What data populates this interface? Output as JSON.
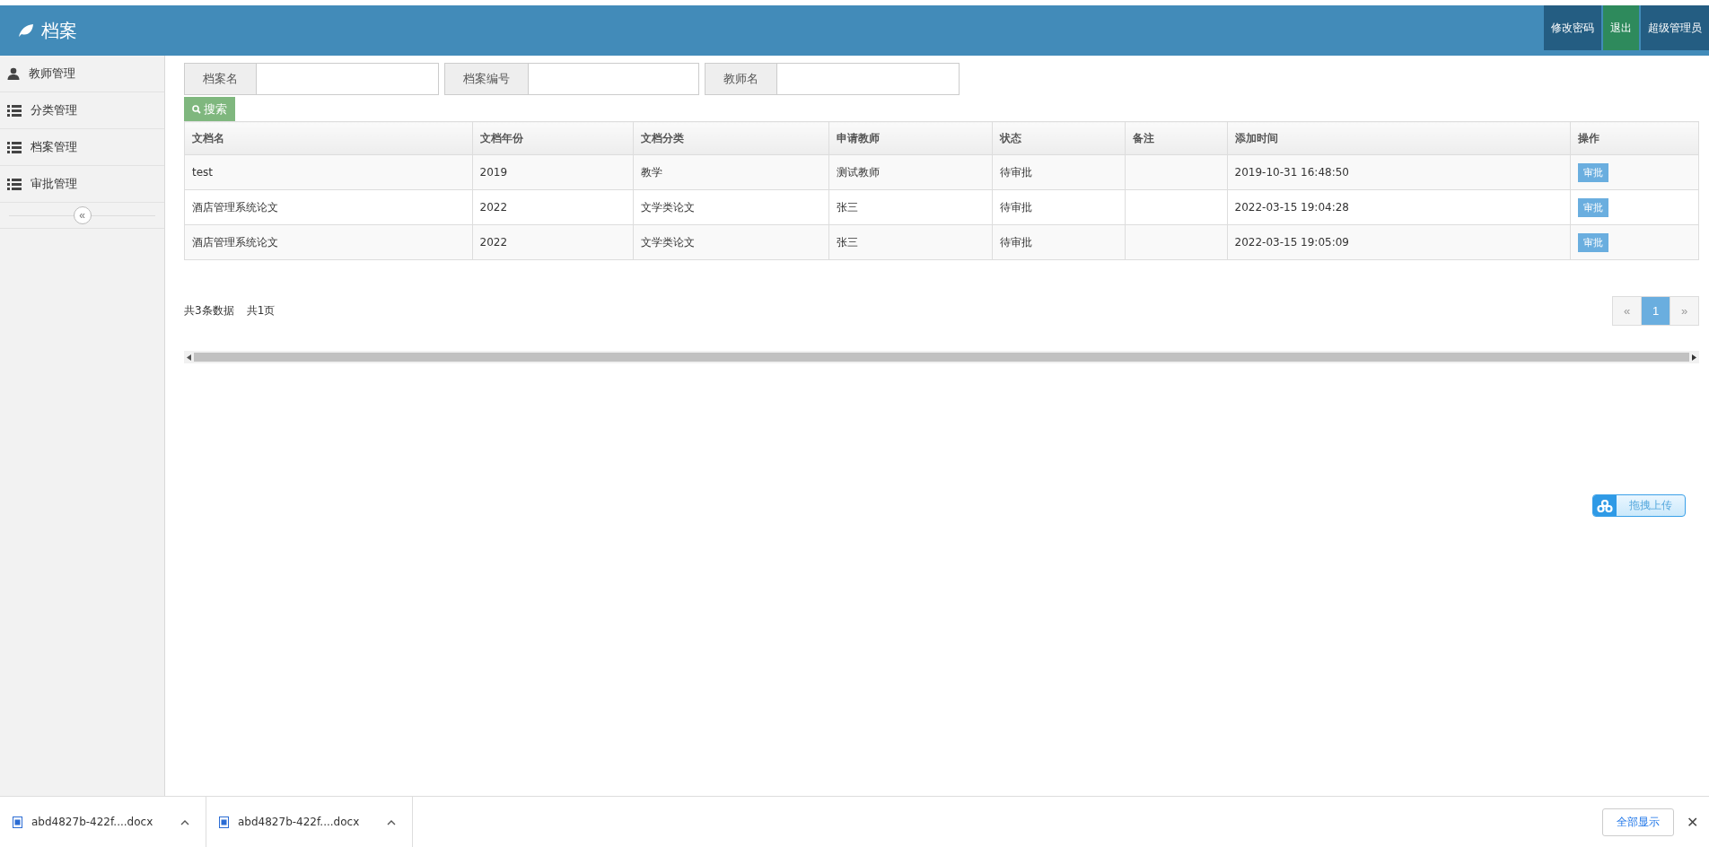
{
  "header": {
    "title": "档案",
    "buttons": [
      {
        "label": "修改密码",
        "kind": "dark"
      },
      {
        "label": "退出",
        "kind": "green"
      },
      {
        "label": "超级管理员",
        "kind": "dark"
      }
    ]
  },
  "sidebar": {
    "items": [
      {
        "label": "教师管理",
        "kind": "user"
      },
      {
        "label": "分类管理",
        "kind": "list"
      },
      {
        "label": "档案管理",
        "kind": "list"
      },
      {
        "label": "审批管理",
        "kind": "list"
      }
    ],
    "collapse": "«"
  },
  "search": {
    "fields": [
      {
        "label": "档案名"
      },
      {
        "label": "档案编号"
      },
      {
        "label": "教师名"
      }
    ],
    "button": "搜索"
  },
  "table": {
    "columns": [
      "文档名",
      "文档年份",
      "文档分类",
      "申请教师",
      "状态",
      "备注",
      "添加时间",
      "操作"
    ],
    "rows": [
      {
        "cells": [
          "test",
          "2019",
          "教学",
          "测试教师",
          "待审批",
          "",
          "2019-10-31 16:48:50"
        ],
        "action": "审批"
      },
      {
        "cells": [
          "酒店管理系统论文",
          "2022",
          "文学类论文",
          "张三",
          "待审批",
          "",
          "2022-03-15 19:04:28"
        ],
        "action": "审批"
      },
      {
        "cells": [
          "酒店管理系统论文",
          "2022",
          "文学类论文",
          "张三",
          "待审批",
          "",
          "2022-03-15 19:05:09"
        ],
        "action": "审批"
      }
    ]
  },
  "summary": [
    "共3条数据",
    "共1页"
  ],
  "pagination": {
    "prev": "«",
    "next": "»",
    "pages": [
      {
        "label": "1",
        "selected": true
      }
    ]
  },
  "upload_button": "拖拽上传",
  "downloads": {
    "items": [
      "abd4827b-422f....docx",
      "abd4827b-422f....docx"
    ],
    "show_all": "全部显示",
    "close": "✕"
  }
}
